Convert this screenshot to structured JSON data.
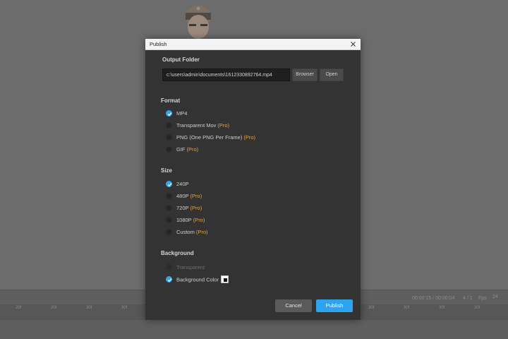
{
  "dialog": {
    "title": "Publish",
    "output_folder": {
      "heading": "Output Folder",
      "path": "c:\\users\\admin\\documents\\1612330892764.mp4",
      "browse_label": "Browser",
      "open_label": "Open"
    },
    "format": {
      "heading": "Format",
      "options": [
        {
          "label": "MP4",
          "pro": "",
          "checked": true
        },
        {
          "label": "Transparent Mov",
          "pro": "(Pro)",
          "checked": false
        },
        {
          "label": "PNG (One PNG Per Frame)",
          "pro": "(Pro)",
          "checked": false
        },
        {
          "label": "GIF",
          "pro": "(Pro)",
          "checked": false
        }
      ]
    },
    "size": {
      "heading": "Size",
      "options": [
        {
          "label": "240P",
          "pro": "",
          "checked": true
        },
        {
          "label": "480P",
          "pro": "(Pro)",
          "checked": false
        },
        {
          "label": "720P",
          "pro": "(Pro)",
          "checked": false
        },
        {
          "label": "1080P",
          "pro": "(Pro)",
          "checked": false
        },
        {
          "label": "Custom",
          "pro": "(Pro)",
          "checked": false
        }
      ]
    },
    "background": {
      "heading": "Background",
      "options": [
        {
          "label": "Transparent",
          "checked": false,
          "disabled": true
        },
        {
          "label": "Background Color",
          "checked": true,
          "disabled": false
        }
      ],
      "color": "#111111"
    },
    "cancel_label": "Cancel",
    "publish_label": "Publish"
  },
  "timeline": {
    "ticks": [
      "20f",
      "20f",
      "30f",
      "30f",
      "30f",
      "30f",
      "30f",
      "30f"
    ],
    "timecode": "00:00:15 / 00:00:04",
    "frame": "4 / 1",
    "fps_label": "Fps",
    "fps_value": "24"
  },
  "colors": {
    "accent": "#2ea3ee",
    "pro": "#e7a437",
    "dialog_bg": "#333333"
  }
}
